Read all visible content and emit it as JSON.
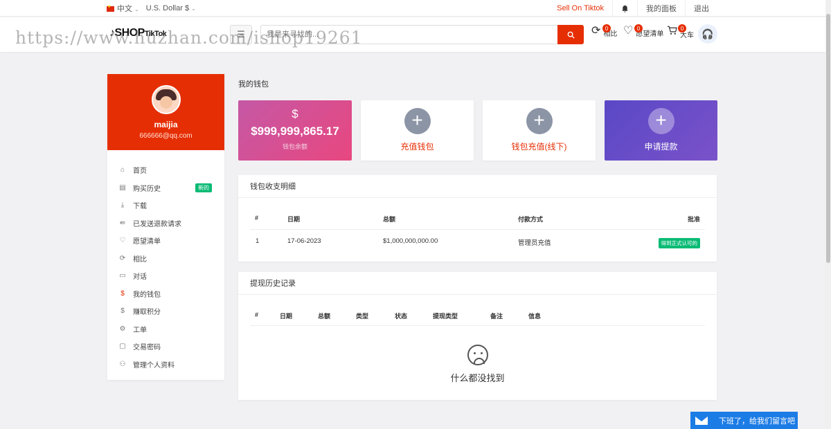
{
  "topbar": {
    "language": "中文",
    "currency": "U.S. Dollar $",
    "sell": "Sell On Tiktok",
    "dashboard": "我的面板",
    "logout": "退出"
  },
  "header": {
    "logo_main": "SHOP",
    "logo_sub": "TikTok",
    "search_placeholder": "我是来寻找的...",
    "compare_label": "相比",
    "compare_count": "0",
    "wishlist_label": "愿望清单",
    "wishlist_count": "0",
    "cart_label": "大车",
    "cart_count": "0",
    "watermark": "https://www.huzhan.com/ishop19261"
  },
  "sidebar": {
    "username": "maijia",
    "email": "666666@qq.com",
    "items": [
      {
        "label": "首页",
        "icon": "home-icon"
      },
      {
        "label": "购买历史",
        "icon": "file-icon",
        "badge": "新的"
      },
      {
        "label": "下载",
        "icon": "download-icon"
      },
      {
        "label": "已发送退款请求",
        "icon": "refund-icon"
      },
      {
        "label": "愿望清单",
        "icon": "heart-icon"
      },
      {
        "label": "相比",
        "icon": "refresh-icon"
      },
      {
        "label": "对话",
        "icon": "chat-icon"
      },
      {
        "label": "我的钱包",
        "icon": "dollar-icon"
      },
      {
        "label": "赚取积分",
        "icon": "dollar-icon"
      },
      {
        "label": "工单",
        "icon": "gear-icon"
      },
      {
        "label": "交易密码",
        "icon": "wallet-icon"
      },
      {
        "label": "管理个人资料",
        "icon": "user-icon"
      }
    ]
  },
  "main": {
    "title": "我的钱包",
    "wallet_symbol": "$",
    "wallet_balance": "$999,999,865.17",
    "wallet_label": "钱包余额",
    "recharge": "充值钱包",
    "offline_recharge": "钱包充值(线下)",
    "withdraw": "申请提款"
  },
  "transactions": {
    "title": "钱包收支明细",
    "headers": [
      "#",
      "日期",
      "总额",
      "付款方式",
      "批准"
    ],
    "rows": [
      {
        "num": "1",
        "date": "17-06-2023",
        "amount": "$1,000,000,000.00",
        "method": "管理员充值",
        "status": "得到正式认可的"
      }
    ]
  },
  "withdrawals": {
    "title": "提现历史记录",
    "headers": [
      "#",
      "日期",
      "总额",
      "类型",
      "状态",
      "提现类型",
      "备注",
      "信息"
    ],
    "empty": "什么都没找到"
  },
  "chat": {
    "label": "下班了，给我们留言吧"
  }
}
